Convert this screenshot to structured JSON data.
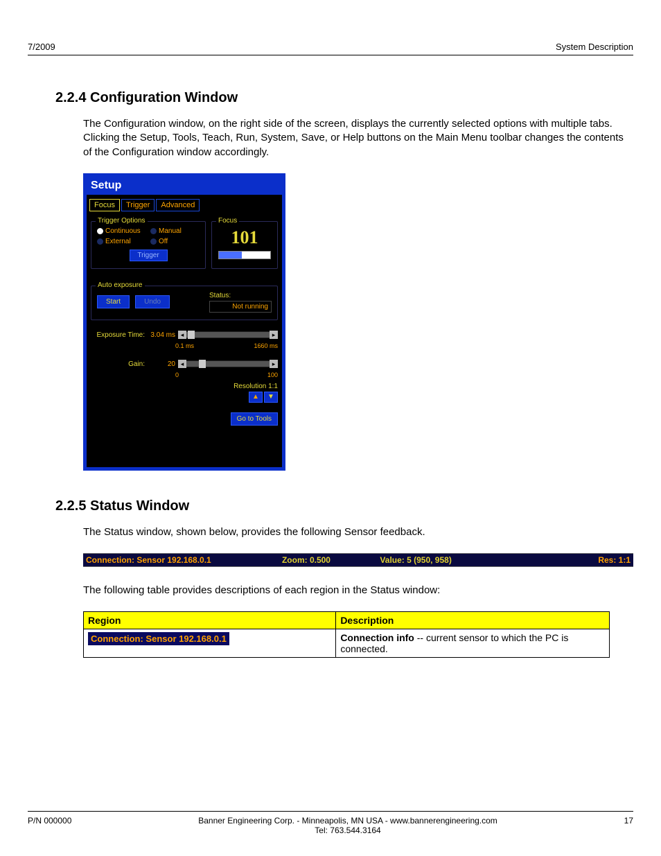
{
  "header": {
    "left": "7/2009",
    "right": "System Description"
  },
  "section1": {
    "heading": "2.2.4 Configuration Window",
    "para": "The Configuration window, on the right side of the screen, displays the currently selected options with multiple tabs. Clicking the Setup, Tools, Teach, Run, System, Save, or Help buttons on the Main Menu toolbar changes the contents of the Configuration window accordingly."
  },
  "setup": {
    "title": "Setup",
    "tabs": {
      "focus": "Focus",
      "trigger": "Trigger",
      "advanced": "Advanced"
    },
    "trigger_options": {
      "legend": "Trigger Options",
      "items": {
        "continuous": "Continuous",
        "manual": "Manual",
        "external": "External",
        "off": "Off"
      },
      "selected": "continuous",
      "trigger_btn": "Trigger"
    },
    "focus": {
      "legend": "Focus",
      "value": "101"
    },
    "auto_exposure": {
      "legend": "Auto exposure",
      "start": "Start",
      "undo": "Undo",
      "status_label": "Status:",
      "status_value": "Not running"
    },
    "exposure": {
      "label": "Exposure Time:",
      "value": "3.04 ms",
      "min": "0.1 ms",
      "max": "1660 ms"
    },
    "gain": {
      "label": "Gain:",
      "value": "20",
      "min": "0",
      "max": "100"
    },
    "resolution_label": "Resolution 1:1",
    "goto": "Go to Tools"
  },
  "section2": {
    "heading": "2.2.5 Status Window",
    "para": "The Status window, shown below, provides the following Sensor feedback.",
    "statusbar": {
      "connection": "Connection: Sensor 192.168.0.1",
      "zoom": "Zoom:  0.500",
      "value": "Value: 5   (950, 958)",
      "res": "Res:  1:1"
    },
    "table_intro": "The following table provides descriptions of each region in the Status window:",
    "table": {
      "headers": {
        "region": "Region",
        "description": "Description"
      },
      "rows": [
        {
          "region": "Connection: Sensor 192.168.0.1",
          "desc_bold": "Connection info",
          "desc_rest": " -- current sensor to which the PC is connected."
        }
      ]
    }
  },
  "footer": {
    "left": "P/N 000000",
    "center1": "Banner Engineering Corp. - Minneapolis, MN USA - www.bannerengineering.com",
    "center2": "Tel: 763.544.3164",
    "right": "17"
  }
}
